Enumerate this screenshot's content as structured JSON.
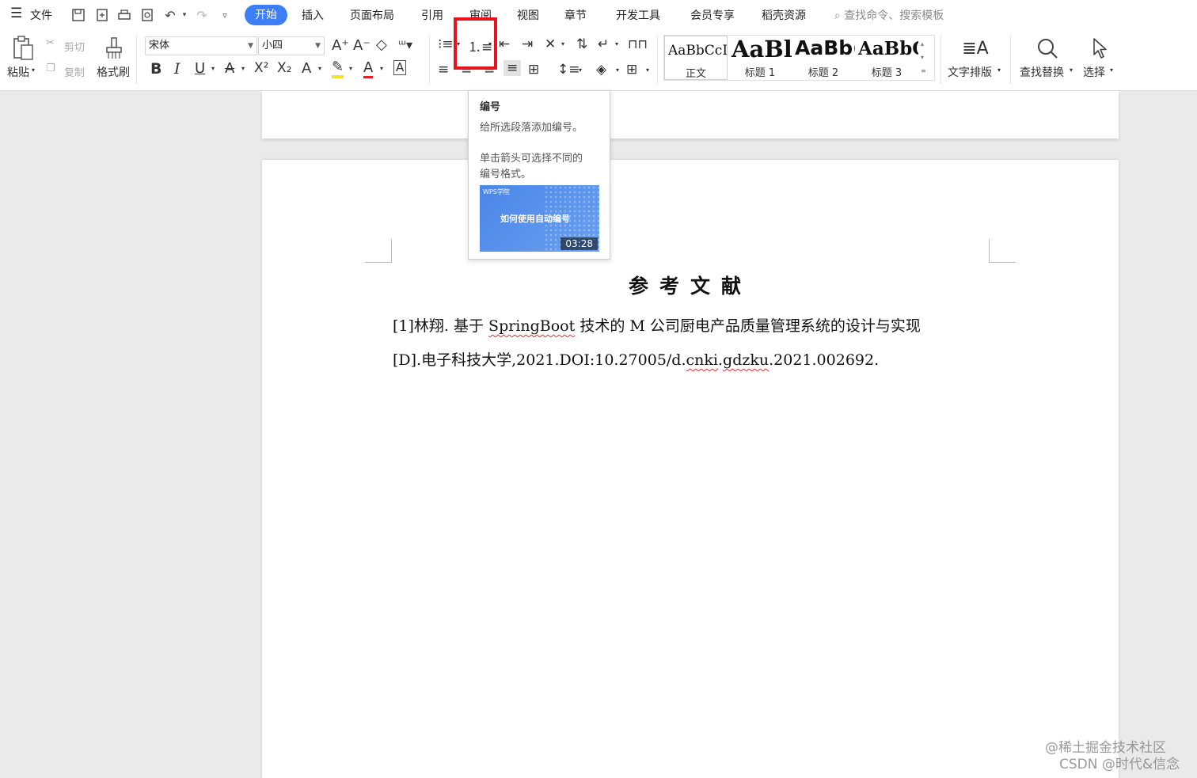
{
  "menubar": {
    "file_label": "文件",
    "tabs": [
      "开始",
      "插入",
      "页面布局",
      "引用",
      "审阅",
      "视图",
      "章节",
      "开发工具",
      "会员专享",
      "稻壳资源"
    ],
    "active_tab": "开始",
    "search_placeholder": "查找命令、搜索模板"
  },
  "ribbon": {
    "paste_label": "粘贴",
    "cut_label": "剪切",
    "copy_label": "复制",
    "format_painter_label": "格式刷",
    "font_name": "宋体",
    "font_size": "小四",
    "styles": [
      {
        "sample": "AaBbCcI",
        "name": "正文"
      },
      {
        "sample": "AaBl",
        "name": "标题 1"
      },
      {
        "sample": "AaBb(",
        "name": "标题 2"
      },
      {
        "sample": "AaBbC",
        "name": "标题 3"
      }
    ],
    "text_layout_label": "文字排版",
    "find_replace_label": "查找替换",
    "select_label": "选择"
  },
  "tooltip": {
    "title": "编号",
    "line1": "给所选段落添加编号。",
    "line2": "单击箭头可选择不同的",
    "line3": "编号格式。",
    "video_brand": "WPS学院",
    "video_title": "如何使用自动编号",
    "video_duration": "03:28"
  },
  "document": {
    "title": "参考文献",
    "ref_line1_a": "[1]林翔. 基于",
    "ref_line1_b": "SpringBoot",
    "ref_line1_c": "技术的 M 公司厨电产品质量管理系统的设计与实现",
    "ref_line2_a": "[D].电子科技大学,2021.DOI:10.27005/d.",
    "ref_line2_b": "cnki",
    "ref_line2_c": ".",
    "ref_line2_d": "gdzku",
    "ref_line2_e": ".2021.002692."
  },
  "watermark": {
    "line1": "@稀土掘金技术社区",
    "line2": "CSDN @时代&信念"
  }
}
